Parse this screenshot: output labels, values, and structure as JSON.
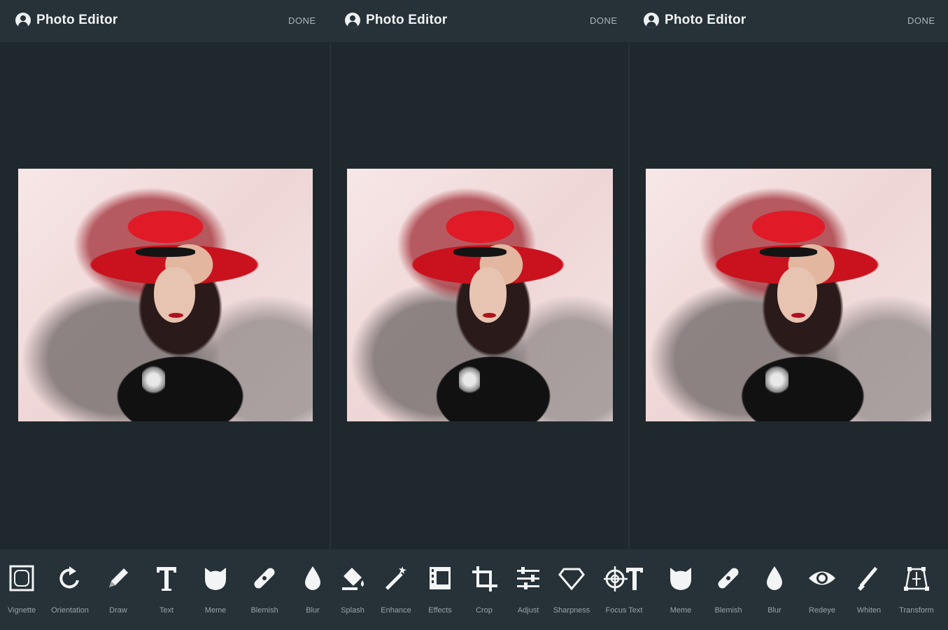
{
  "panels": [
    {
      "title": "Photo Editor",
      "done_label": "DONE"
    },
    {
      "title": "Photo Editor",
      "done_label": "DONE"
    },
    {
      "title": "Photo Editor",
      "done_label": "DONE"
    }
  ],
  "colors": {
    "background": "#1f282d",
    "header": "#263138",
    "title_text": "#f2f4f5",
    "tool_label": "#9aa4a9",
    "icon": "#f2f4f5"
  },
  "toolbar": {
    "tools": [
      {
        "label": "Vignette",
        "icon": "vignette-icon"
      },
      {
        "label": "Orientation",
        "icon": "rotate-icon"
      },
      {
        "label": "Draw",
        "icon": "pencil-icon"
      },
      {
        "label": "Text",
        "icon": "text-icon"
      },
      {
        "label": "Meme",
        "icon": "cat-face-icon"
      },
      {
        "label": "Blemish",
        "icon": "bandage-icon"
      },
      {
        "label": "Blur",
        "icon": "drop-icon"
      },
      {
        "label": "Splash",
        "icon": "paint-bucket-icon"
      },
      {
        "label": "Enhance",
        "icon": "magic-wand-icon"
      },
      {
        "label": "Effects",
        "icon": "film-icon"
      },
      {
        "label": "Crop",
        "icon": "crop-icon"
      },
      {
        "label": "Adjust",
        "icon": "sliders-icon"
      },
      {
        "label": "Sharpness",
        "icon": "diamond-icon"
      },
      {
        "label": "Focus Text",
        "icon": "focus-text-icon"
      },
      {
        "label": "Meme",
        "icon": "cat-face-icon"
      },
      {
        "label": "Blemish",
        "icon": "bandage-icon"
      },
      {
        "label": "Blur",
        "icon": "drop-icon"
      },
      {
        "label": "Redeye",
        "icon": "eye-icon"
      },
      {
        "label": "Whiten",
        "icon": "brush-icon"
      },
      {
        "label": "Transform",
        "icon": "transform-icon"
      }
    ]
  }
}
